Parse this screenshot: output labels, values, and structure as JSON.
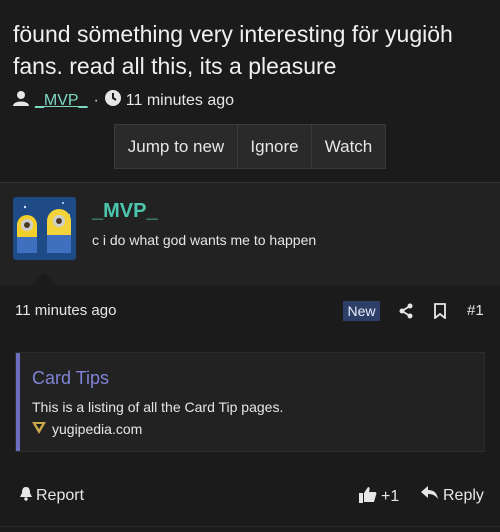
{
  "thread": {
    "title": "föund sömething very interesting för yugiöh fans. read all this, its a pleasure",
    "author": "_MVP_",
    "separator": "·",
    "time": "11 minutes ago",
    "actions": [
      "Jump to new",
      "Ignore",
      "Watch"
    ]
  },
  "post": {
    "author": "_MVP_",
    "signature": "c i do what god wants me to happen",
    "time": "11 minutes ago",
    "badge": "New",
    "number": "#1",
    "link_card": {
      "title": "Card Tips",
      "description": "This is a listing of all the Card Tip pages.",
      "domain": "yugipedia.com"
    },
    "footer": {
      "report_label": "Report",
      "like_count": "+1",
      "reply_label": "Reply"
    }
  },
  "icons": {
    "user": "user-icon",
    "clock": "clock-icon",
    "share": "share-icon",
    "bookmark": "bookmark-icon",
    "bell": "bell-icon",
    "thumbs_up": "thumbs-up-icon",
    "reply": "reply-icon",
    "favicon": "yugipedia-favicon-icon"
  },
  "colors": {
    "background": "#1b1b1b",
    "panel": "#222222",
    "username": "#4cc7ae",
    "link_title": "#7f84d8",
    "badge": "#2d3f66"
  }
}
